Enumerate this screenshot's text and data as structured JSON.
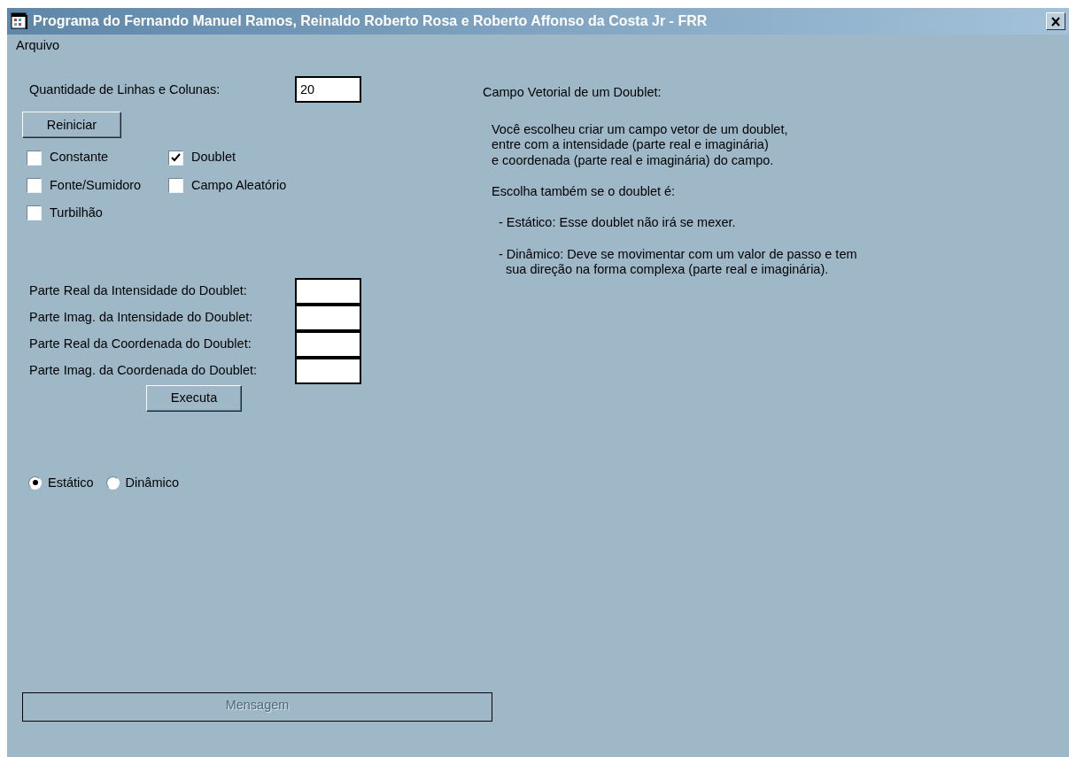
{
  "window": {
    "title": "Programa do Fernando Manuel Ramos, Reinaldo Roberto Rosa e Roberto Affonso da Costa Jr - FRR"
  },
  "menu": [
    "Arquivo"
  ],
  "grid_size": {
    "label": "Quantidade de Linhas e Colunas:",
    "value": "20"
  },
  "reset_button": "Reiniciar",
  "options": [
    {
      "label": "Constante",
      "checked": false
    },
    {
      "label": "Doublet",
      "checked": true
    },
    {
      "label": "Fonte/Sumidoro",
      "checked": false
    },
    {
      "label": "Campo Aleatório",
      "checked": false
    },
    {
      "label": "Turbilhão",
      "checked": false
    }
  ],
  "fields": [
    {
      "label": "Parte Real da Intensidade do Doublet:"
    },
    {
      "label": "Parte Imag. da Intensidade do Doublet:"
    },
    {
      "label": "Parte Real da Coordenada do Doublet:"
    },
    {
      "label": "Parte Imag. da Coordenada do Doublet:"
    }
  ],
  "execute_button": "Executa",
  "modes": [
    {
      "label": "Estático",
      "selected": true
    },
    {
      "label": "Dinâmico",
      "selected": false
    }
  ],
  "help": {
    "title": "Campo Vetorial de um Doublet:",
    "paragraphs": [
      "Você escolheu criar um campo vetor de um doublet,\nentre com a intensidade (parte real e imaginária)\ne coordenada (parte real e imaginária) do campo.",
      "Escolha também se o doublet é:"
    ],
    "bullets": [
      "- Estático: Esse doublet não irá se mexer.",
      "- Dinâmico: Deve se movimentar com um valor de passo e tem\nsua direção na forma complexa (parte real e imaginária)."
    ]
  },
  "message_bar": {
    "text": "Mensagem",
    "disabled": true
  }
}
